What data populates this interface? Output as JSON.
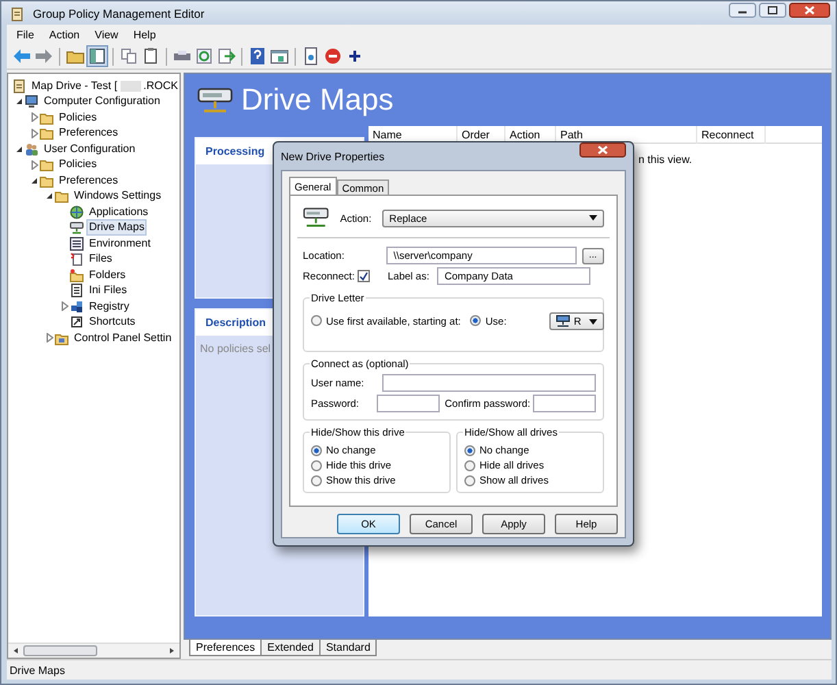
{
  "window": {
    "title": "Group Policy Management Editor"
  },
  "menu": [
    "File",
    "Action",
    "View",
    "Help"
  ],
  "tree": {
    "root": {
      "label": "Map Drive - Test [",
      "label_end": ".ROCK",
      "selected": false
    },
    "items": [
      {
        "label": "Computer Configuration",
        "kind": "computer",
        "expanded": true,
        "selected": false,
        "children": [
          {
            "label": "Policies",
            "kind": "folder",
            "expanded": false,
            "selected": false
          },
          {
            "label": "Preferences",
            "kind": "folder",
            "expanded": false,
            "selected": false
          }
        ]
      },
      {
        "label": "User Configuration",
        "kind": "user",
        "expanded": true,
        "selected": false,
        "children": [
          {
            "label": "Policies",
            "kind": "folder",
            "expanded": false,
            "selected": false
          },
          {
            "label": "Preferences",
            "kind": "folder",
            "expanded": true,
            "selected": false,
            "children": [
              {
                "label": "Windows Settings",
                "kind": "folder",
                "expanded": true,
                "selected": false,
                "children": [
                  {
                    "label": "Applications",
                    "kind": "apps",
                    "selected": false
                  },
                  {
                    "label": "Drive Maps",
                    "kind": "drive",
                    "selected": true
                  },
                  {
                    "label": "Environment",
                    "kind": "environment",
                    "selected": false
                  },
                  {
                    "label": "Files",
                    "kind": "files",
                    "selected": false
                  },
                  {
                    "label": "Folders",
                    "kind": "folders",
                    "selected": false
                  },
                  {
                    "label": "Ini Files",
                    "kind": "ini",
                    "selected": false
                  },
                  {
                    "label": "Registry",
                    "kind": "registry",
                    "expanded": false,
                    "selected": false
                  },
                  {
                    "label": "Shortcuts",
                    "kind": "shortcut",
                    "selected": false
                  }
                ]
              },
              {
                "label": "Control Panel Settin",
                "kind": "control",
                "expanded": false,
                "selected": false
              }
            ]
          }
        ]
      }
    ]
  },
  "right_pane": {
    "heading": "Drive Maps",
    "processing": {
      "title": "Processing"
    },
    "description": {
      "title": "Description",
      "text": "No policies sel"
    },
    "list": {
      "columns": [
        "Name",
        "Order",
        "Action",
        "Path",
        "Reconnect"
      ],
      "empty_text": "n this view."
    }
  },
  "dialog": {
    "title": "New Drive Properties",
    "tabs": [
      {
        "label": "General",
        "selected": true
      },
      {
        "label": "Common",
        "selected": false
      }
    ],
    "action": {
      "label": "Action:",
      "value": "Replace"
    },
    "location": {
      "label": "Location:",
      "value": "\\\\server\\company",
      "browse": "..."
    },
    "reconnect": {
      "label": "Reconnect:",
      "checked": true
    },
    "label_as": {
      "label": "Label as:",
      "value": "Company Data"
    },
    "drive_letter": {
      "title": "Drive Letter",
      "options": [
        {
          "label": "Use first available, starting at:",
          "selected": false
        },
        {
          "label": "Use:",
          "selected": true
        }
      ],
      "letter": "R"
    },
    "connect_as": {
      "title": "Connect as (optional)",
      "user_label": "User name:",
      "password_label": "Password:",
      "confirm_label": "Confirm password:"
    },
    "hide_show_drive": {
      "title": "Hide/Show this drive",
      "options": [
        {
          "label": "No change",
          "selected": true
        },
        {
          "label": "Hide this drive",
          "selected": false
        },
        {
          "label": "Show this drive",
          "selected": false
        }
      ]
    },
    "hide_show_all": {
      "title": "Hide/Show all drives",
      "options": [
        {
          "label": "No change",
          "selected": true
        },
        {
          "label": "Hide all drives",
          "selected": false
        },
        {
          "label": "Show all drives",
          "selected": false
        }
      ]
    },
    "buttons": [
      {
        "label": "OK",
        "default": true
      },
      {
        "label": "Cancel",
        "default": false
      },
      {
        "label": "Apply",
        "default": false
      },
      {
        "label": "Help",
        "default": false
      }
    ]
  },
  "bottom_tabs": [
    {
      "label": "Preferences",
      "selected": true
    },
    {
      "label": "Extended",
      "selected": false
    },
    {
      "label": "Standard",
      "selected": false
    }
  ],
  "status_bar": "Drive Maps"
}
